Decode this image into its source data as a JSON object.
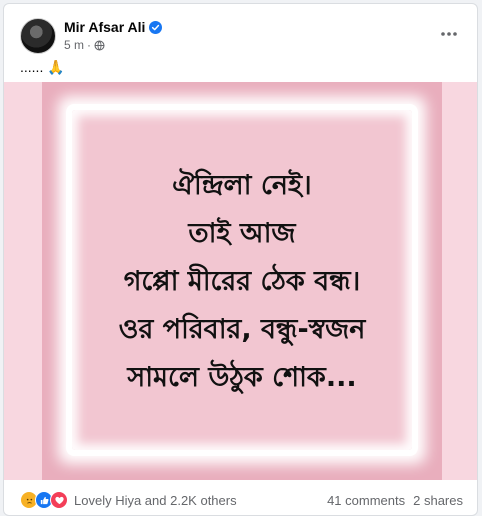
{
  "post": {
    "author": "Mir Afsar Ali",
    "time": "5 m",
    "separator": "·",
    "caption": "...... 🙏",
    "verified_color": "#1877f2"
  },
  "image": {
    "lines": [
      "ঐন্দ্রিলা নেই।",
      "তাই আজ",
      "গপ্পো মীরের ঠেক বন্ধ।",
      "ওর পরিবার, বন্ধু-স্বজন",
      "সামলে উঠুক শোক..."
    ],
    "outer_color": "#f8d7e0",
    "inner_color": "#e9aebd",
    "frame_color": "#f2c6d1"
  },
  "footer": {
    "reactions": [
      "sad-icon",
      "like-icon",
      "love-icon"
    ],
    "reactors_text": "Lovely Hiya and 2.2K others",
    "comments": "41 comments",
    "shares": "2 shares"
  }
}
